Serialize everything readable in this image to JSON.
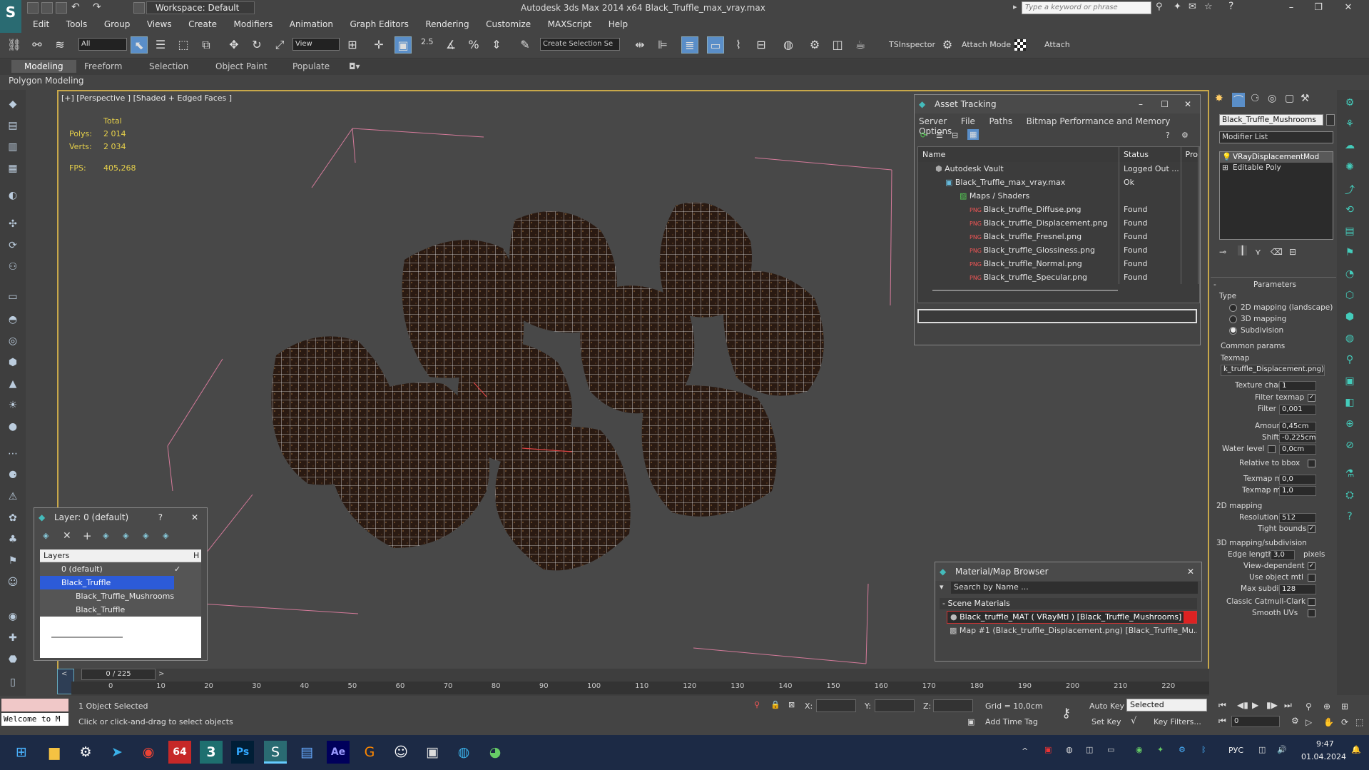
{
  "app": {
    "workspace": "Workspace: Default",
    "title": "Autodesk 3ds Max  2014 x64    Black_Truffle_max_vray.max",
    "search_placeholder": "Type a keyword or phrase"
  },
  "menu": [
    "Edit",
    "Tools",
    "Group",
    "Views",
    "Create",
    "Modifiers",
    "Animation",
    "Graph Editors",
    "Rendering",
    "Customize",
    "MAXScript",
    "Help"
  ],
  "toolbar": {
    "filter": "All",
    "refcoord": "View",
    "angle_snap": "2.5",
    "selection_set": "Create Selection Se",
    "tsinspector": "TSInspector",
    "attach_mode": "Attach Mode",
    "attach": "Attach"
  },
  "ribbon": {
    "tabs": [
      "Modeling",
      "Freeform",
      "Selection",
      "Object Paint",
      "Populate"
    ],
    "subtitle": "Polygon Modeling"
  },
  "viewport": {
    "label": "[+] [Perspective ] [Shaded + Edged Faces ]",
    "stats_header": "Total",
    "polys_label": "Polys:",
    "polys": "2 014",
    "verts_label": "Verts:",
    "verts": "2 034",
    "fps_label": "FPS:",
    "fps": "405,268"
  },
  "asset_tracking": {
    "title": "Asset Tracking",
    "menu": [
      "Server",
      "File",
      "Paths",
      "Bitmap Performance and Memory",
      "Options"
    ],
    "col_name": "Name",
    "col_status": "Status",
    "col_pro": "Pro",
    "rows": [
      {
        "name": "Autodesk Vault",
        "status": "Logged Out ..."
      },
      {
        "name": "Black_Truffle_max_vray.max",
        "status": "Ok"
      },
      {
        "name": "Maps / Shaders",
        "status": ""
      },
      {
        "name": "Black_truffle_Diffuse.png",
        "status": "Found"
      },
      {
        "name": "Black_truffle_Displacement.png",
        "status": "Found"
      },
      {
        "name": "Black_truffle_Fresnel.png",
        "status": "Found"
      },
      {
        "name": "Black_truffle_Glossiness.png",
        "status": "Found"
      },
      {
        "name": "Black_truffle_Normal.png",
        "status": "Found"
      },
      {
        "name": "Black_truffle_Specular.png",
        "status": "Found"
      }
    ]
  },
  "material_browser": {
    "title": "Material/Map Browser",
    "search": "Search by Name ...",
    "section": "- Scene Materials",
    "items": [
      "Black_truffle_MAT  ( VRayMtl )  [Black_Truffle_Mushrooms]",
      "Map #1 (Black_truffle_Displacement.png) [Black_Truffle_Mu..."
    ]
  },
  "layer_panel": {
    "title": "Layer: 0 (default)",
    "help": "?",
    "col_layers": "Layers",
    "col_h": "H",
    "rows": [
      "0 (default)",
      "Black_Truffle",
      "Black_Truffle_Mushrooms",
      "Black_Truffle"
    ]
  },
  "command_panel": {
    "object_name": "Black_Truffle_Mushrooms",
    "modifier_list": "Modifier List",
    "stack": [
      "VRayDisplacementMod",
      "Editable Poly"
    ],
    "parameters": "Parameters",
    "type_label": "Type",
    "type_options": [
      "2D mapping (landscape)",
      "3D mapping",
      "Subdivision"
    ],
    "common_params": "Common params",
    "texmap_label": "Texmap",
    "texmap": "k_truffle_Displacement.png)",
    "texture_chan_label": "Texture chan",
    "texture_chan": "1",
    "filter_texmap": "Filter texmap",
    "filter_blur_label": "Filter blur",
    "filter_blur": "0,001",
    "amount_label": "Amount",
    "amount": "0,45cm",
    "shift_label": "Shift",
    "shift": "-0,225cm",
    "water_level_label": "Water level",
    "water_level": "0,0cm",
    "relative_bbox": "Relative to bbox",
    "texmap_min_label": "Texmap min",
    "texmap_min": "0,0",
    "texmap_max_label": "Texmap max",
    "texmap_max": "1,0",
    "mapping2d": "2D mapping",
    "resolution_label": "Resolution",
    "resolution": "512",
    "tight_bounds": "Tight bounds",
    "mapping3d": "3D mapping/subdivision",
    "edge_length_label": "Edge length",
    "edge_length": "3,0",
    "pixels": "pixels",
    "view_dependent": "View-dependent",
    "use_object_mtl": "Use object mtl",
    "max_subdivs_label": "Max subdivs",
    "max_subdivs": "128",
    "classic_catmull": "Classic Catmull-Clark",
    "smooth_uvs": "Smooth UVs"
  },
  "timeline": {
    "frame": "0 / 225",
    "ticks": [
      "0",
      "10",
      "20",
      "30",
      "40",
      "50",
      "60",
      "70",
      "80",
      "90",
      "100",
      "110",
      "120",
      "130",
      "140",
      "150",
      "160",
      "170",
      "180",
      "190",
      "200",
      "210",
      "220"
    ]
  },
  "status": {
    "welcome": "Welcome to M",
    "selected": "1 Object Selected",
    "hint": "Click or click-and-drag to select objects",
    "x_label": "X:",
    "y_label": "Y:",
    "z_label": "Z:",
    "grid": "Grid = 10,0cm",
    "add_time_tag": "Add Time Tag",
    "auto_key": "Auto Key",
    "set_key": "Set Key",
    "key_mode": "Selected",
    "key_filters": "Key Filters...",
    "frame_field": "0"
  },
  "taskbar": {
    "lang": "РУС",
    "time": "9:47",
    "date": "01.04.2024",
    "badge": "64"
  }
}
